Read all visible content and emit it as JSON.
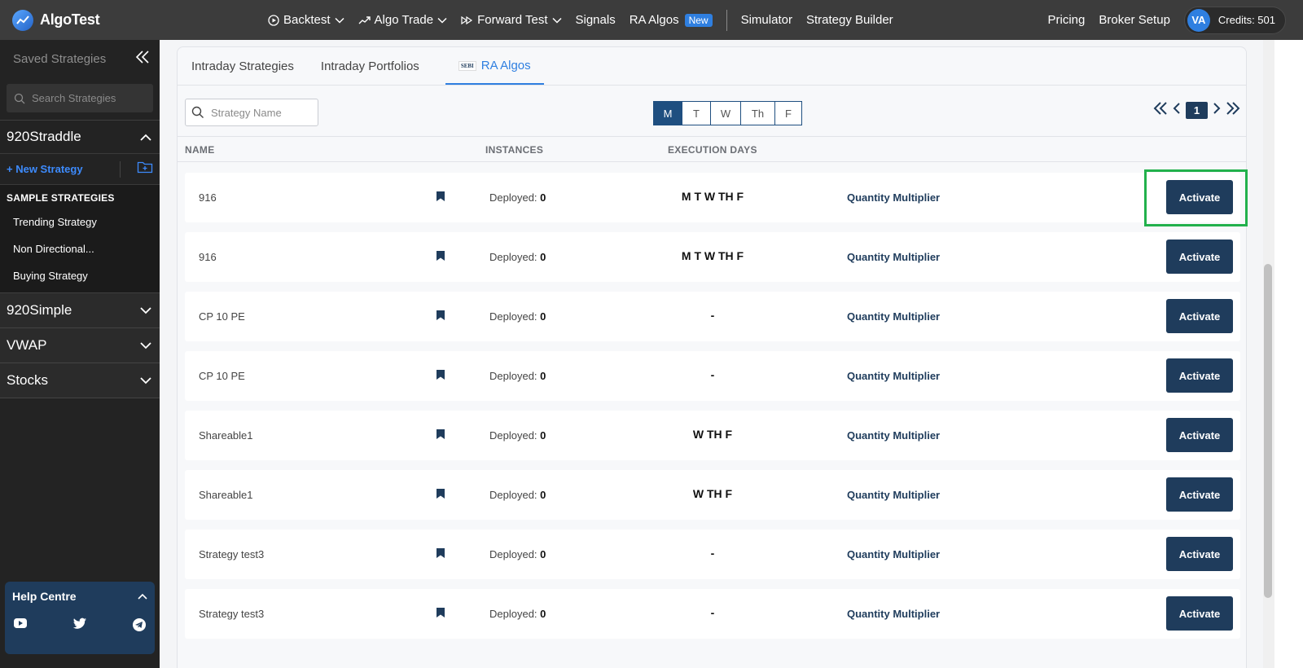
{
  "header": {
    "logo_text": "AlgoTest",
    "nav": [
      {
        "label": "Backtest",
        "icon": "play-circle-icon",
        "dropdown": true
      },
      {
        "label": "Algo Trade",
        "icon": "trending-up-icon",
        "dropdown": true
      },
      {
        "label": "Forward Test",
        "icon": "fast-forward-icon",
        "dropdown": true
      },
      {
        "label": "Signals"
      },
      {
        "label": "RA Algos",
        "badge": "New"
      },
      {
        "label": "Simulator"
      },
      {
        "label": "Strategy Builder"
      }
    ],
    "pricing_label": "Pricing",
    "broker_setup_label": "Broker Setup",
    "avatar_initials": "VA",
    "credits_label": "Credits: 501"
  },
  "sidebar": {
    "title": "Saved Strategies",
    "search_placeholder": "Search Strategies",
    "open_group": "920Straddle",
    "new_strategy_label": "+ New Strategy",
    "sample_title": "SAMPLE STRATEGIES",
    "sample_items": [
      "Trending Strategy",
      "Non Directional...",
      "Buying Strategy"
    ],
    "groups": [
      "920Simple",
      "VWAP",
      "Stocks"
    ],
    "help_title": "Help Centre"
  },
  "tabs": [
    {
      "label": "Intraday Strategies",
      "active": false
    },
    {
      "label": "Intraday Portfolios",
      "active": false
    },
    {
      "label": "RA Algos",
      "active": true,
      "prefix": "SEBI"
    }
  ],
  "toolbar": {
    "search_placeholder": "Strategy Name",
    "days": [
      {
        "label": "M",
        "active": true
      },
      {
        "label": "T",
        "active": false
      },
      {
        "label": "W",
        "active": false
      },
      {
        "label": "Th",
        "active": false
      },
      {
        "label": "F",
        "active": false
      }
    ],
    "page": "1"
  },
  "table": {
    "headers": {
      "name": "NAME",
      "instances": "INSTANCES",
      "execution_days": "EXECUTION DAYS"
    },
    "rows": [
      {
        "name": "916",
        "deployed_label": "Deployed:",
        "deployed": "0",
        "days": "M T W TH F",
        "qm": "Quantity Multiplier",
        "action": "Activate"
      },
      {
        "name": "916",
        "deployed_label": "Deployed:",
        "deployed": "0",
        "days": "M T W TH F",
        "qm": "Quantity Multiplier",
        "action": "Activate"
      },
      {
        "name": "CP 10 PE",
        "deployed_label": "Deployed:",
        "deployed": "0",
        "days": "-",
        "qm": "Quantity Multiplier",
        "action": "Activate"
      },
      {
        "name": "CP 10 PE",
        "deployed_label": "Deployed:",
        "deployed": "0",
        "days": "-",
        "qm": "Quantity Multiplier",
        "action": "Activate"
      },
      {
        "name": "Shareable1",
        "deployed_label": "Deployed:",
        "deployed": "0",
        "days": "W TH F",
        "qm": "Quantity Multiplier",
        "action": "Activate"
      },
      {
        "name": "Shareable1",
        "deployed_label": "Deployed:",
        "deployed": "0",
        "days": "W TH F",
        "qm": "Quantity Multiplier",
        "action": "Activate"
      },
      {
        "name": "Strategy test3",
        "deployed_label": "Deployed:",
        "deployed": "0",
        "days": "-",
        "qm": "Quantity Multiplier",
        "action": "Activate"
      },
      {
        "name": "Strategy test3",
        "deployed_label": "Deployed:",
        "deployed": "0",
        "days": "-",
        "qm": "Quantity Multiplier",
        "action": "Activate"
      }
    ]
  },
  "colors": {
    "accent": "#2f7fe0",
    "primary_dark": "#1f3c5c",
    "highlight": "#22b14c"
  }
}
